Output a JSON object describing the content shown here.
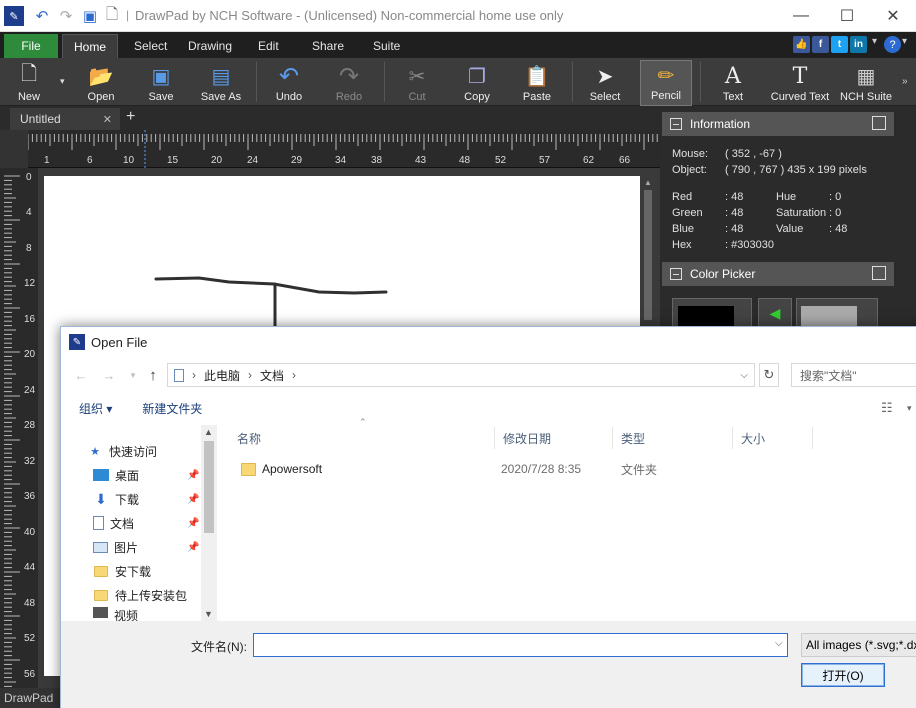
{
  "window": {
    "title": "DrawPad by NCH Software - (Unlicensed) Non-commercial home use only",
    "min_label": "—",
    "max_label": "☐",
    "close_label": "✕"
  },
  "ribbon": {
    "tabs": [
      "File",
      "Home",
      "Select",
      "Drawing",
      "Edit",
      "Share",
      "Suite"
    ],
    "social": [
      "👍",
      "f",
      "t",
      "in"
    ]
  },
  "toolbar": {
    "buttons": [
      {
        "label": "New",
        "icon": "new-document-icon"
      },
      {
        "label": "Open",
        "icon": "open-folder-icon"
      },
      {
        "label": "Save",
        "icon": "save-icon"
      },
      {
        "label": "Save As",
        "icon": "save-as-icon"
      },
      {
        "label": "Undo",
        "icon": "undo-icon"
      },
      {
        "label": "Redo",
        "icon": "redo-icon"
      },
      {
        "label": "Cut",
        "icon": "scissors-icon"
      },
      {
        "label": "Copy",
        "icon": "copy-icon"
      },
      {
        "label": "Paste",
        "icon": "paste-icon"
      },
      {
        "label": "Select",
        "icon": "cursor-icon"
      },
      {
        "label": "Pencil",
        "icon": "pencil-icon"
      },
      {
        "label": "Text",
        "icon": "text-icon"
      },
      {
        "label": "Curved Text",
        "icon": "curved-text-icon"
      },
      {
        "label": "NCH Suite",
        "icon": "nch-suite-icon"
      }
    ]
  },
  "document": {
    "tab_name": "Untitled",
    "close_glyph": "✕",
    "add_glyph": "+"
  },
  "rulers": {
    "h_labels": [
      "1",
      "6",
      "10",
      "15",
      "20",
      "24",
      "29",
      "34",
      "38",
      "43",
      "48",
      "52",
      "57",
      "62",
      "66"
    ],
    "v_labels": [
      "0",
      "4",
      "8",
      "12",
      "16",
      "20",
      "24",
      "28",
      "32",
      "36",
      "40",
      "44",
      "48",
      "52",
      "56"
    ]
  },
  "info_panel": {
    "title": "Information",
    "mouse_label": "Mouse:",
    "mouse_value": "( 352 , -67 )",
    "object_label": "Object:",
    "object_value": "( 790 , 767 ) 435 x 199 pixels",
    "red_label": "Red",
    "red_value": ": 48",
    "green_label": "Green",
    "green_value": ": 48",
    "blue_label": "Blue",
    "blue_value": ": 48",
    "hex_label": "Hex",
    "hex_value": ": #303030",
    "hue_label": "Hue",
    "hue_value": ": 0",
    "sat_label": "Saturation",
    "sat_value": ": 0",
    "val_label": "Value",
    "val_value": ": 48"
  },
  "color_picker": {
    "title": "Color Picker"
  },
  "status": {
    "text": "DrawPad"
  },
  "dialog": {
    "title": "Open File",
    "path": [
      "此电脑",
      "文档"
    ],
    "search_placeholder": "搜索\"文档\"",
    "organize": "组织 ▾",
    "new_folder": "新建文件夹",
    "nav_items": [
      {
        "label": "快速访问",
        "icon": "star-icon"
      },
      {
        "label": "桌面",
        "icon": "desktop-icon"
      },
      {
        "label": "下载",
        "icon": "download-icon"
      },
      {
        "label": "文档",
        "icon": "document-icon"
      },
      {
        "label": "图片",
        "icon": "picture-icon"
      },
      {
        "label": "安下载",
        "icon": "folder-icon"
      },
      {
        "label": "待上传安装包",
        "icon": "folder-icon"
      },
      {
        "label": "视频",
        "icon": "video-icon"
      }
    ],
    "columns": [
      "名称",
      "修改日期",
      "类型",
      "大小"
    ],
    "files": [
      {
        "name": "Apowersoft",
        "date": "2020/7/28 8:35",
        "type": "文件夹",
        "size": ""
      }
    ],
    "filename_label": "文件名(N):",
    "filename_value": "",
    "filter": "All images (*.svg;*.dxf;*.png",
    "open_button": "打开(O)"
  },
  "colors": {
    "accent_green": "#2e8b3c",
    "dark_bg": "#2b2b2b",
    "toolbar_bg": "#3c3c3c",
    "stroke": "#303030"
  }
}
